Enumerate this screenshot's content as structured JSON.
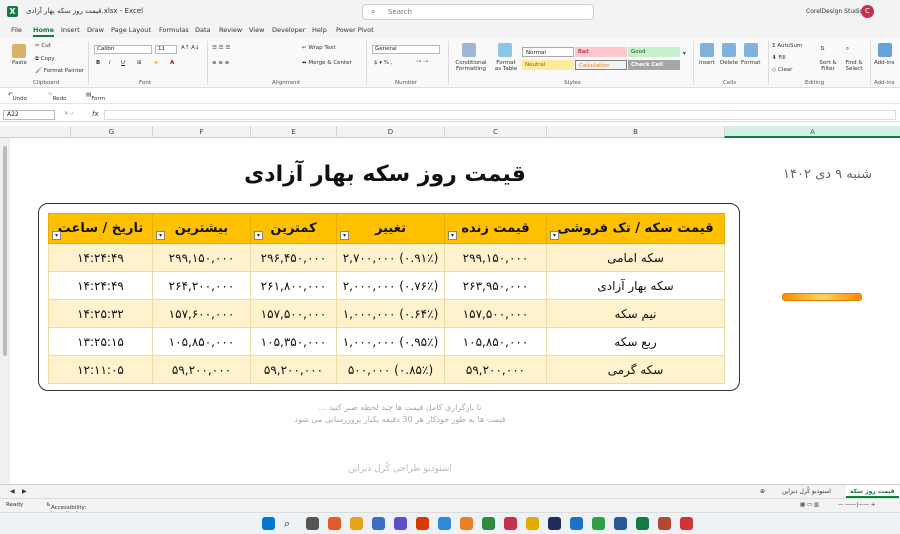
{
  "window": {
    "title": "قیمت روز سکه بهار آزادی.xlsx - Excel",
    "search_placeholder": "Search",
    "user_name": "CorelDesign Studio",
    "avatar_initial": "C"
  },
  "menu": [
    "File",
    "Home",
    "Insert",
    "Draw",
    "Page Layout",
    "Formulas",
    "Data",
    "Review",
    "View",
    "Developer",
    "Help",
    "Power Pivot"
  ],
  "ribbon": {
    "clipboard": {
      "paste": "Paste",
      "cut": "Cut",
      "copy": "Copy",
      "format_painter": "Format Painter",
      "group": "Clipboard"
    },
    "font": {
      "name": "Calibri",
      "size": "11",
      "group": "Font"
    },
    "alignment": {
      "wrap": "Wrap Text",
      "merge": "Merge & Center",
      "group": "Alignment"
    },
    "number": {
      "format": "General",
      "group": "Number"
    },
    "styles": {
      "conditional": "Conditional Formatting",
      "format_table": "Format as Table",
      "normal": "Normal",
      "bad": "Bad",
      "good": "Good",
      "neutral": "Neutral",
      "calculation": "Calculation",
      "check_cell": "Check Cell",
      "group": "Styles"
    },
    "cells": {
      "insert": "Insert",
      "delete": "Delete",
      "format": "Format",
      "group": "Cells"
    },
    "editing": {
      "autosum": "AutoSum",
      "fill": "Fill",
      "clear": "Clear",
      "sort": "Sort & Filter",
      "find": "Find & Select",
      "group": "Editing"
    },
    "addins": {
      "label": "Add-ins",
      "group": "Add-ins"
    }
  },
  "qat": {
    "undo": "Undo",
    "redo": "Redo",
    "form": "Form"
  },
  "formula_bar": {
    "name_box": "A22",
    "fx": "fx"
  },
  "columns": [
    "G",
    "F",
    "E",
    "D",
    "C",
    "B",
    "A"
  ],
  "sheet": {
    "title": "قیمت روز سکه بهار آزادی",
    "date": "شنبه ۹ دی ۱۴۰۲",
    "headers": [
      "قیمت سکه / تک فروشی",
      "قیمت زنده",
      "تغییر",
      "کمترین",
      "بیشترین",
      "تاریخ / ساعت"
    ],
    "rows": [
      [
        "سکه امامی",
        "۲۹۹,۱۵۰,۰۰۰",
        "(۰.۹۱٪) ۲,۷۰۰,۰۰۰",
        "۲۹۶,۴۵۰,۰۰۰",
        "۲۹۹,۱۵۰,۰۰۰",
        "۱۴:۲۴:۴۹"
      ],
      [
        "سکه بهار آزادی",
        "۲۶۳,۹۵۰,۰۰۰",
        "(۰.۷۶٪) ۲,۰۰۰,۰۰۰",
        "۲۶۱,۸۰۰,۰۰۰",
        "۲۶۴,۲۰۰,۰۰۰",
        "۱۴:۲۴:۴۹"
      ],
      [
        "نیم سکه",
        "۱۵۷,۵۰۰,۰۰۰",
        "(۰.۶۴٪) ۱,۰۰۰,۰۰۰",
        "۱۵۷,۵۰۰,۰۰۰",
        "۱۵۷,۶۰۰,۰۰۰",
        "۱۴:۲۵:۳۲"
      ],
      [
        "ربع سکه",
        "۱۰۵,۸۵۰,۰۰۰",
        "(۰.۹۵٪) ۱,۰۰۰,۰۰۰",
        "۱۰۵,۳۵۰,۰۰۰",
        "۱۰۵,۸۵۰,۰۰۰",
        "۱۳:۲۵:۱۵"
      ],
      [
        "سکه گرمی",
        "۵۹,۲۰۰,۰۰۰",
        "(۰.۸۵٪) ۵۰۰,۰۰۰",
        "۵۹,۲۰۰,۰۰۰",
        "۵۹,۲۰۰,۰۰۰",
        "۱۲:۱۱:۰۵"
      ]
    ],
    "note_line1": "تا بارگزاری کامل قیمت ها چند لحظه صبر کنید ...",
    "note_line2": "قیمت ها به طور خودکار هر 30 دقیقه یکبار بروزرسانی می شود",
    "watermark": "استودیو طراحی کُرل دیزاین"
  },
  "sheet_tabs": [
    "قیمت روز سکه",
    "استودیو کُرل دیزاین"
  ],
  "status": {
    "ready": "Ready",
    "accessibility": "Accessibility: Investigate"
  }
}
